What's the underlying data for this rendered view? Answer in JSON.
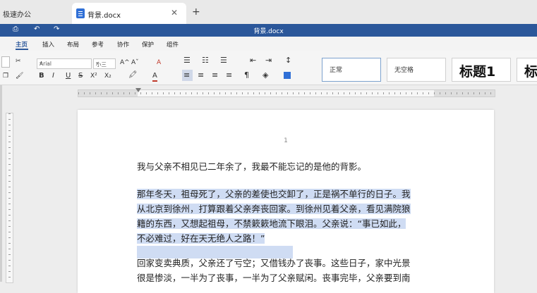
{
  "tabs": {
    "inactive_title": "极速办公",
    "active_title": "背景.docx",
    "close_glyph": "✕",
    "new_tab_glyph": "+"
  },
  "titlebar": {
    "doc_title": "背景.docx",
    "print_glyph": "⎙",
    "undo_glyph": "↶",
    "redo_glyph": "↷"
  },
  "menu": {
    "items": [
      "主页",
      "插入",
      "布局",
      "参考",
      "协作",
      "保护",
      "组件"
    ],
    "active_index": 0
  },
  "ribbon": {
    "font_name": "Arial",
    "font_size": "小三",
    "bold": "B",
    "italic": "I",
    "underline": "U",
    "strike": "S",
    "superscript": "X²",
    "subscript": "X₂",
    "grow_font": "A^",
    "shrink_font": "Aˇ",
    "clear_format": "A",
    "font_color": "A",
    "highlight": "🖍",
    "paragraph_mark": "¶",
    "styles": [
      "正常",
      "无空格",
      "标题1",
      "标"
    ],
    "accent_color": "#2b579a"
  },
  "document": {
    "page_number": "1",
    "paragraph1": "我与父亲不相见已二年余了，我最不能忘记的是他的背影。",
    "paragraph2_lines": [
      "那年冬天，祖母死了，父亲的差使也交卸了，正是祸不单行的日子。我",
      "从北京到徐州，打算跟着父亲奔丧回家。到徐州见着父亲，看见满院狼",
      "籍的东西，又想起祖母，不禁簌簌地流下眼泪。父亲说：“事已如此，",
      "不必难过，好在天无绝人之路！”"
    ],
    "paragraph3_lines": [
      "回家变卖典质，父亲还了亏空；又借钱办了丧事。这些日子，家中光景",
      "很是惨淡，一半为了丧事，一半为了父亲赋闲。丧事完毕，父亲要到南"
    ],
    "selection_color": "#cfdcf3"
  }
}
